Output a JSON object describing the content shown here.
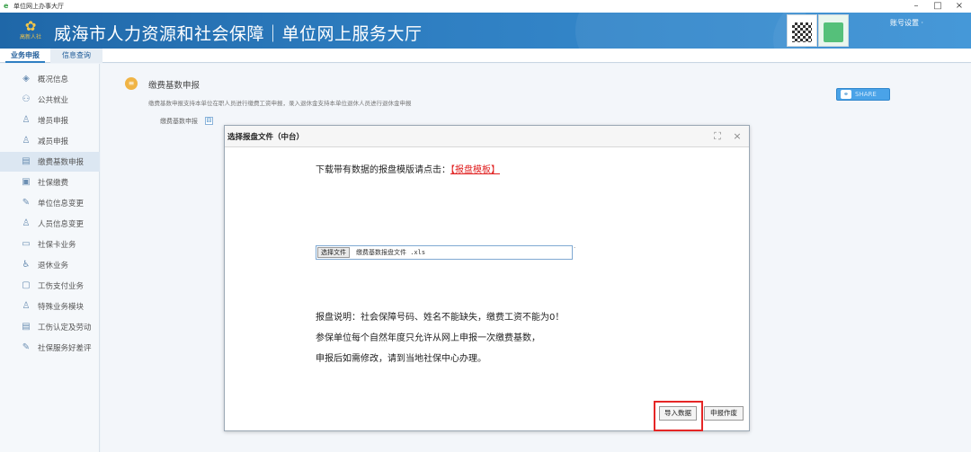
{
  "window": {
    "title": "单位网上办事大厅",
    "min": "–",
    "max": "□",
    "close": "×"
  },
  "header": {
    "logo_text": "高新人社",
    "site_title": "威海市人力资源和社会保障｜单位网上服务大厅",
    "account": "账号设置 ·"
  },
  "tabs": {
    "business": "业务申报",
    "query": "信息查询"
  },
  "sidebar": {
    "items": [
      {
        "label": "概况信息",
        "icon": "layers-icon"
      },
      {
        "label": "公共就业",
        "icon": "people-icon"
      },
      {
        "label": "增员申报",
        "icon": "user-add-icon"
      },
      {
        "label": "减员申报",
        "icon": "user-minus-icon"
      },
      {
        "label": "缴费基数申报",
        "icon": "document-icon"
      },
      {
        "label": "社保缴费",
        "icon": "payment-icon"
      },
      {
        "label": "单位信息变更",
        "icon": "edit-icon"
      },
      {
        "label": "人员信息变更",
        "icon": "user-edit-icon"
      },
      {
        "label": "社保卡业务",
        "icon": "card-icon"
      },
      {
        "label": "退休业务",
        "icon": "retire-icon"
      },
      {
        "label": "工伤支付业务",
        "icon": "briefcase-icon"
      },
      {
        "label": "特殊业务模块",
        "icon": "user-star-icon"
      },
      {
        "label": "工伤认定及劳动",
        "icon": "document-icon"
      },
      {
        "label": "社保服务好差评",
        "icon": "edit-icon"
      }
    ],
    "active_index": 4
  },
  "main": {
    "section_title": "缴费基数申报",
    "description": "缴费基数申报支持本单位在职人员进行缴费工资申报，录入退休金支持本单位退休人员进行退休金申报",
    "field_label": "缴费基数申报",
    "field_box": "⊟",
    "blue_button_label": "SHARE"
  },
  "dialog": {
    "title": "选择报盘文件（中台）",
    "download_prompt": "下载带有数据的报盘模版请点击：",
    "download_link": "【报盘模板】",
    "choose_file_button": "选择文件",
    "file_name": "缴费基数报盘文件 .xls",
    "notes": [
      "报盘说明：社会保障号码、姓名不能缺失，缴费工资不能为0！",
      "参保单位每个自然年度只允许从网上申报一次缴费基数，",
      "申报后如需修改，请到当地社保中心办理。"
    ],
    "import_button": "导入数据",
    "abandon_button": "申报作废",
    "accent_red": "#e52626"
  },
  "colors": {
    "header_blue": "#2f7fc2",
    "link_red": "#e02020"
  }
}
